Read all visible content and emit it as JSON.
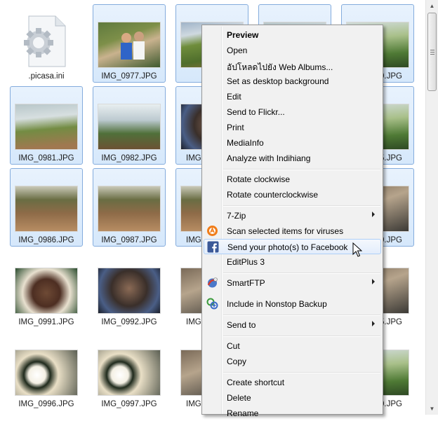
{
  "files": [
    {
      "name": ".picasa.ini",
      "kind": "settings-file",
      "selected": false
    },
    {
      "name": "IMG_0977.JPG",
      "photo": "people",
      "selected": true
    },
    {
      "name": "",
      "photo": "green",
      "selected": true
    },
    {
      "name": "",
      "photo": "field",
      "selected": true
    },
    {
      "name": "IMG_0980.JPG",
      "label_visible": "0.JPG",
      "photo": "green2",
      "selected": true
    },
    {
      "name": "IMG_0981.JPG",
      "photo": "field",
      "selected": true
    },
    {
      "name": "IMG_0982.JPG",
      "photo": "tree",
      "selected": true
    },
    {
      "name": "IMG",
      "photo": "dark",
      "selected": true
    },
    {
      "name": "",
      "photo": "site",
      "selected": true
    },
    {
      "name": "IMG_0985.JPG",
      "label_visible": "5.JPG",
      "photo": "green2",
      "selected": true
    },
    {
      "name": "IMG_0986.JPG",
      "photo": "site",
      "selected": true
    },
    {
      "name": "IMG_0987.JPG",
      "photo": "site",
      "selected": true
    },
    {
      "name": "IMG",
      "photo": "site",
      "selected": true
    },
    {
      "name": "",
      "photo": "site",
      "selected": true
    },
    {
      "name": "IMG_0990.JPG",
      "label_visible": "0.JPG",
      "photo": "misc",
      "selected": true
    },
    {
      "name": "IMG_0991.JPG",
      "photo": "food",
      "selected": false
    },
    {
      "name": "IMG_0992.JPG",
      "photo": "dark",
      "selected": false
    },
    {
      "name": "IMG",
      "photo": "misc",
      "selected": false
    },
    {
      "name": "",
      "photo": "misc",
      "selected": false
    },
    {
      "name": "IMG_0995.JPG",
      "label_visible": "5.JPG",
      "photo": "misc",
      "selected": false
    },
    {
      "name": "IMG_0996.JPG",
      "photo": "sushi",
      "selected": false
    },
    {
      "name": "IMG_0997.JPG",
      "photo": "sushi",
      "selected": false
    },
    {
      "name": "IMG",
      "photo": "misc",
      "selected": false
    },
    {
      "name": "",
      "photo": "misc",
      "selected": false
    },
    {
      "name": "IMG_1000.JPG",
      "label_visible": "0.JPG",
      "photo": "green2",
      "selected": false
    }
  ],
  "labels": {
    "f0": ".picasa.ini",
    "f1": "IMG_0977.JPG",
    "f4": "0.JPG",
    "f5": "IMG_0981.JPG",
    "f6": "IMG_0982.JPG",
    "f7": "IMG",
    "f9": "5.JPG",
    "f10": "IMG_0986.JPG",
    "f11": "IMG_0987.JPG",
    "f12": "IMG",
    "f14": "0.JPG",
    "f15": "IMG_0991.JPG",
    "f16": "IMG_0992.JPG",
    "f17": "IMG",
    "f19": "5.JPG",
    "f20": "IMG_0996.JPG",
    "f21": "IMG_0997.JPG",
    "f22": "IMG",
    "f24": "0.JPG"
  },
  "context_menu": {
    "preview": "Preview",
    "open": "Open",
    "upload_web_albums": "อัปโหลดไปยัง Web Albums...",
    "set_desktop_bg": "Set as desktop background",
    "edit": "Edit",
    "send_flickr": "Send to Flickr...",
    "print": "Print",
    "mediainfo": "MediaInfo",
    "analyze_indihiang": "Analyze with Indihiang",
    "rotate_cw": "Rotate clockwise",
    "rotate_ccw": "Rotate counterclockwise",
    "seven_zip": "7-Zip",
    "scan_viruses": "Scan selected items for viruses",
    "send_facebook": "Send your photo(s) to Facebook",
    "editplus": "EditPlus 3",
    "smartftp": "SmartFTP",
    "nonstop_backup": "Include in Nonstop Backup",
    "send_to": "Send to",
    "cut": "Cut",
    "copy": "Copy",
    "create_shortcut": "Create shortcut",
    "delete": "Delete",
    "rename": "Rename"
  },
  "icons": {
    "avast": "avast-icon",
    "facebook": "facebook-icon",
    "smartftp": "smartftp-icon",
    "nonstop": "nonstop-backup-icon"
  },
  "colors": {
    "selection_fill": "#dbeafb",
    "selection_border": "#84acdd",
    "menu_bg": "#f1f1f1",
    "facebook_blue": "#3b5998",
    "avast_orange": "#f07d1a"
  }
}
